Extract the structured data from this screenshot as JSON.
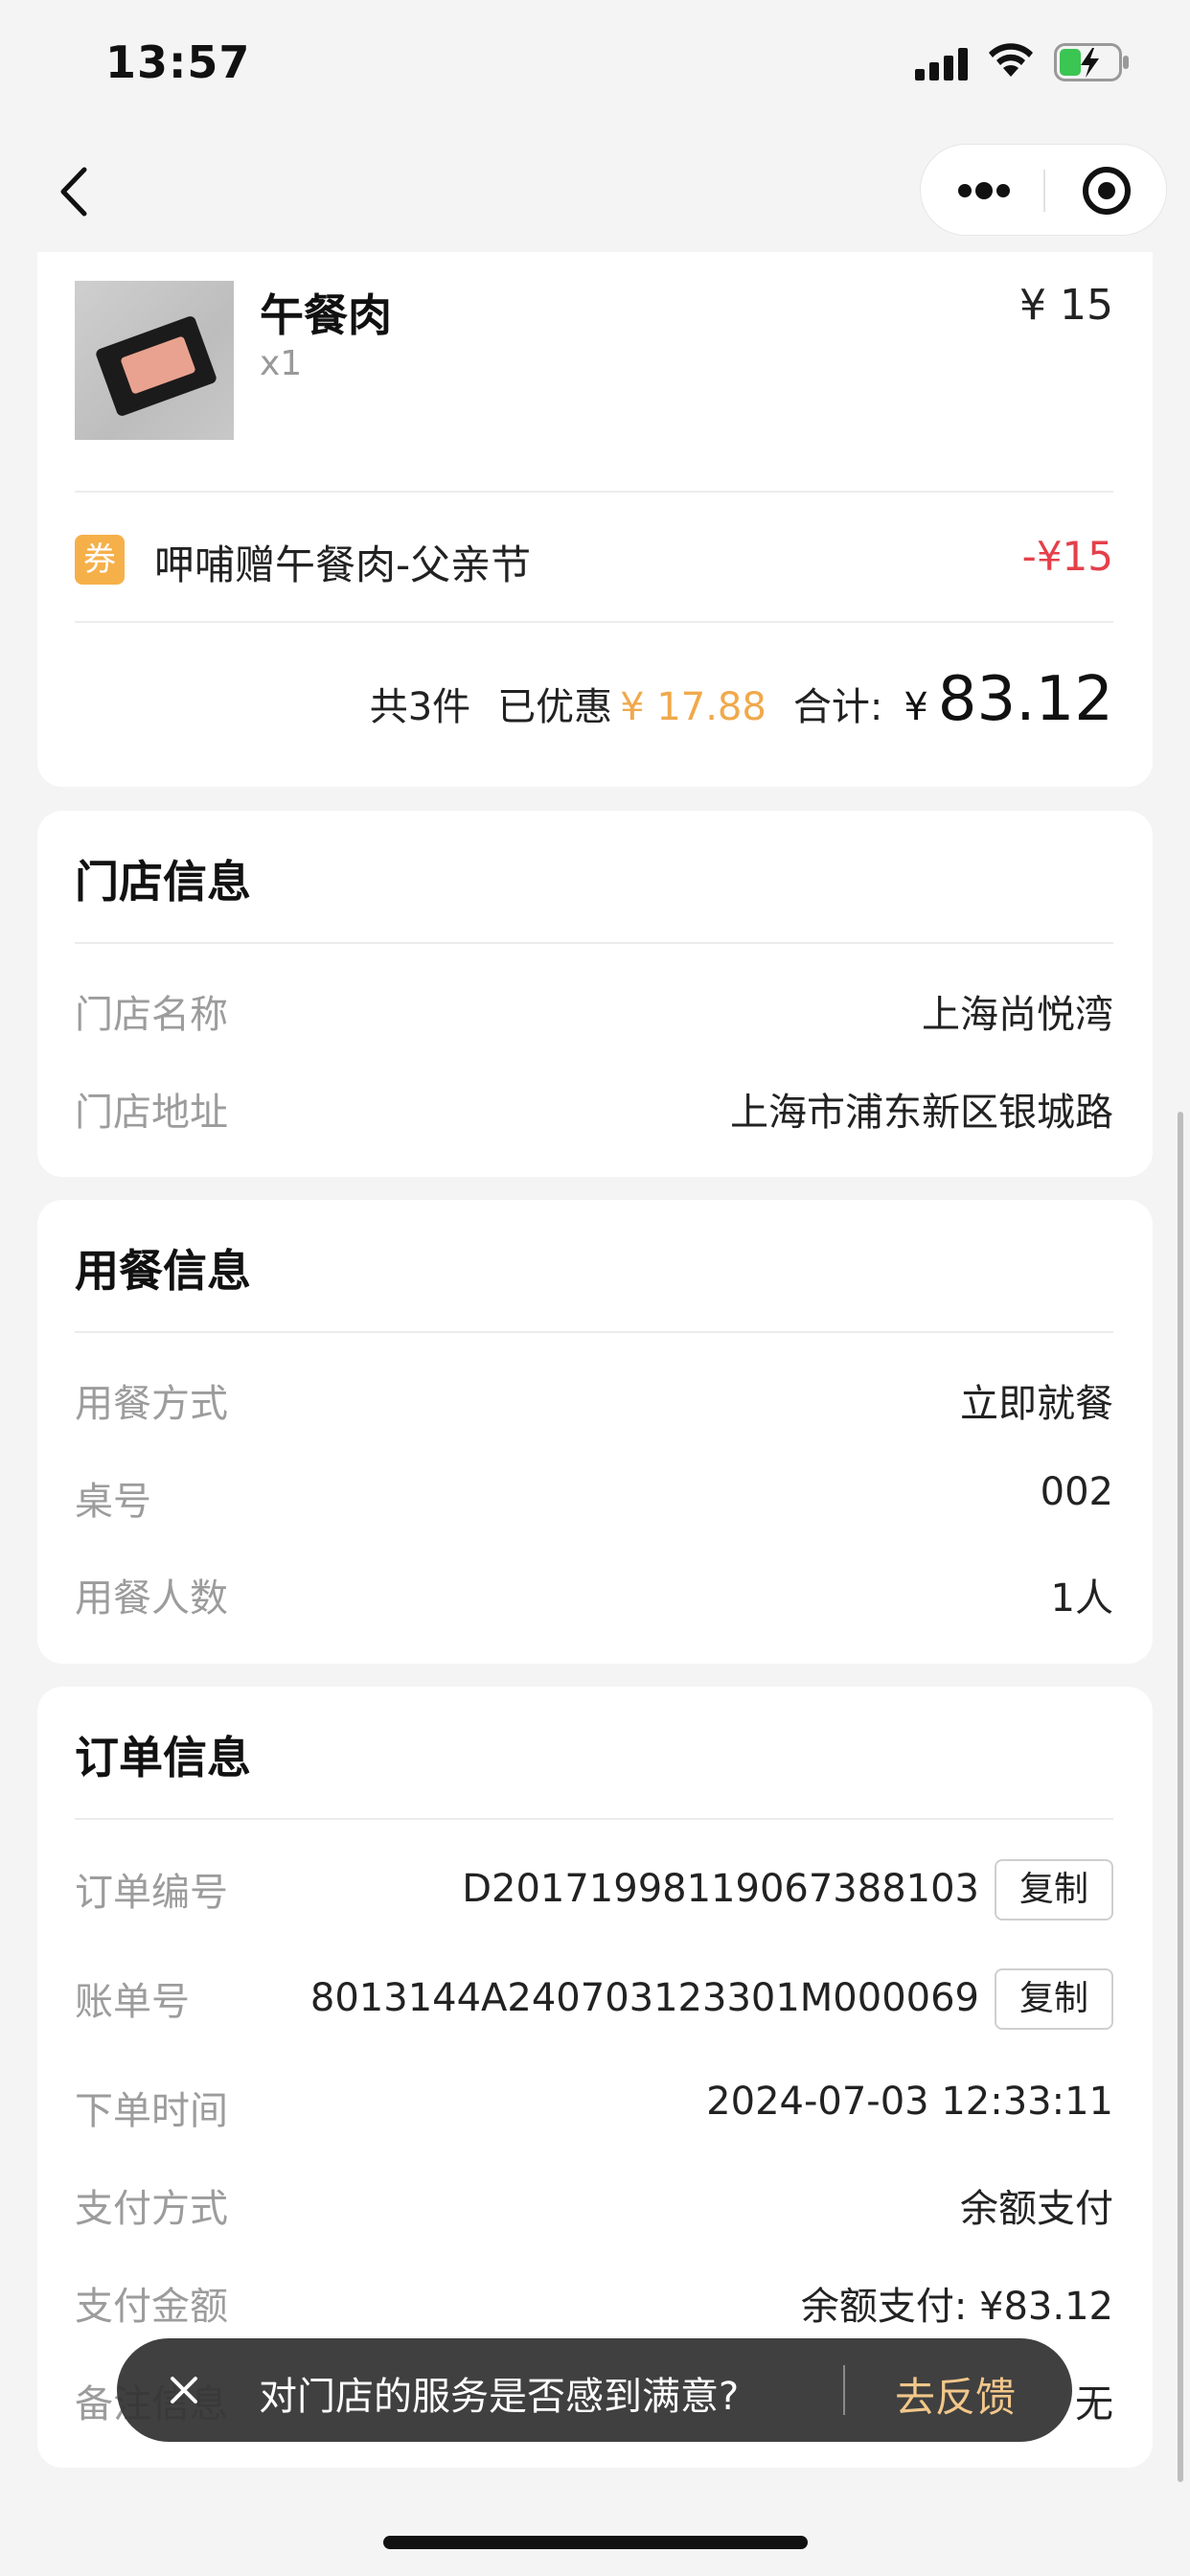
{
  "status_bar": {
    "time": "13:57"
  },
  "order_items": {
    "item": {
      "name": "午餐肉",
      "quantity": "x1",
      "price": "¥ 15"
    },
    "coupon": {
      "badge": "券",
      "name": "呷哺赠午餐肉-父亲节",
      "amount": "-¥15"
    },
    "summary": {
      "count": "共3件",
      "discount_label": "已优惠",
      "discount_value": "¥ 17.88",
      "total_label": "合计:",
      "currency": "¥",
      "total_value": "83.12"
    }
  },
  "store_info": {
    "title": "门店信息",
    "rows": [
      {
        "label": "门店名称",
        "value": "上海尚悦湾"
      },
      {
        "label": "门店地址",
        "value": "上海市浦东新区银城路"
      }
    ]
  },
  "dining_info": {
    "title": "用餐信息",
    "rows": [
      {
        "label": "用餐方式",
        "value": "立即就餐"
      },
      {
        "label": "桌号",
        "value": "002"
      },
      {
        "label": "用餐人数",
        "value": "1人"
      }
    ]
  },
  "order_info": {
    "title": "订单信息",
    "copy_label": "复制",
    "rows": [
      {
        "label": "订单编号",
        "value": "D2017199811906738810​3"
      },
      {
        "label": "账单号",
        "value": "8013144A240703123301M000069"
      },
      {
        "label": "下单时间",
        "value": "2024-07-03 12:33:11"
      },
      {
        "label": "支付方式",
        "value": "余额支付"
      },
      {
        "label": "支付金额",
        "value": "余额支付: ¥83.12"
      },
      {
        "label": "备注信息",
        "value": "无"
      }
    ]
  },
  "feedback_toast": {
    "text": "对门店的服务是否感到满意?",
    "action": "去反馈"
  }
}
